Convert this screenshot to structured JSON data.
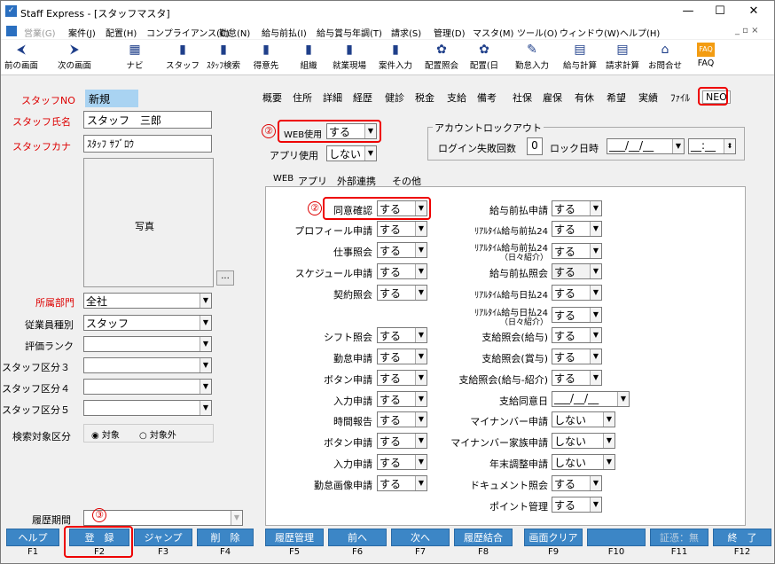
{
  "window": {
    "title": "Staff Express - [スタッフマスタ]",
    "min": "—",
    "max": "☐",
    "close": "✕"
  },
  "menu": [
    "営業(G)",
    "案件(J)",
    "配置(H)",
    "コンプライアンス(C)",
    "勤怠(N)",
    "給与前払(I)",
    "給与賞与年調(T)",
    "請求(S)",
    "管理(D)",
    "マスタ(M)",
    "ツール(O)",
    "ウィンドウ(W)",
    "ヘルプ(H)"
  ],
  "toolbar": [
    {
      "label": "前の画面",
      "icon": "arrow-left-icon",
      "glyph": "⮜"
    },
    {
      "label": "次の画面",
      "icon": "arrow-right-icon",
      "glyph": "⮞"
    },
    {
      "label": "ナビ",
      "icon": "navi-icon",
      "glyph": "▦"
    },
    {
      "label": "スタッフ",
      "icon": "staff-icon",
      "glyph": "▮"
    },
    {
      "label": "ｽﾀｯﾌ検索",
      "icon": "staff-search-icon",
      "glyph": "▮"
    },
    {
      "label": "得意先",
      "icon": "client-icon",
      "glyph": "▮"
    },
    {
      "label": "組織",
      "icon": "org-icon",
      "glyph": "▮"
    },
    {
      "label": "就業現場",
      "icon": "site-icon",
      "glyph": "▮"
    },
    {
      "label": "案件入力",
      "icon": "job-icon",
      "glyph": "▮"
    },
    {
      "label": "配置照会",
      "icon": "assign-icon",
      "glyph": "✿"
    },
    {
      "label": "配置(日",
      "icon": "assign-day-icon",
      "glyph": "✿"
    },
    {
      "label": "勤怠入力",
      "icon": "attendance-icon",
      "glyph": "✎"
    },
    {
      "label": "給与計算",
      "icon": "payroll-icon",
      "glyph": "▤"
    },
    {
      "label": "請求計算",
      "icon": "billing-icon",
      "glyph": "▤"
    },
    {
      "label": "お問合せ",
      "icon": "inquiry-icon",
      "glyph": "⌂"
    },
    {
      "label": "FAQ",
      "icon": "faq-icon",
      "glyph": "FAQ"
    }
  ],
  "left": {
    "staff_no_label": "スタッフNO",
    "staff_no_value": "新規",
    "name_label": "スタッフ氏名",
    "name_value": "スタッフ　三郎",
    "kana_label": "スタッフカナ",
    "kana_value": "ｽﾀｯﾌ ｻﾌﾞﾛｳ",
    "photo_label": "写真",
    "photo_btn": "...",
    "dept_label": "所属部門",
    "dept_value": "全社",
    "emp_type_label": "従業員種別",
    "emp_type_value": "スタッフ",
    "rank_label": "評価ランク",
    "cat3_label": "スタッフ区分３",
    "cat4_label": "スタッフ区分４",
    "cat5_label": "スタッフ区分５",
    "search_label": "検索対象区分",
    "radio_on": "対象",
    "radio_off": "対象外",
    "history_label": "履歴期間"
  },
  "tabs": [
    "概要",
    "住所",
    "詳細",
    "経歴",
    "健診",
    "税金",
    "支給",
    "備考",
    "社保",
    "雇保",
    "有休",
    "希望",
    "実績",
    "ﾌｧｲﾙ",
    "NEO"
  ],
  "neo": {
    "web_use_label": "WEB使用",
    "web_use_value": "する",
    "app_use_label": "アプリ使用",
    "app_use_value": "しない",
    "lock_group": "アカウントロックアウト",
    "login_fail_label": "ログイン失敗回数",
    "login_fail_value": "0",
    "lock_date_label": "ロック日時",
    "lock_date_value": "___/__/__",
    "lock_time_value": "__:__"
  },
  "subtabs": [
    "WEB",
    "アプリ",
    "外部連携",
    "その他"
  ],
  "web_left": [
    {
      "label": "同意確認",
      "value": "する"
    },
    {
      "label": "プロフィール申請",
      "value": "する"
    },
    {
      "label": "仕事照会",
      "value": "する"
    },
    {
      "label": "スケジュール申請",
      "value": "する"
    },
    {
      "label": "契約照会",
      "value": "する"
    },
    {
      "label": "シフト照会",
      "value": "する"
    },
    {
      "label": "勤怠申請",
      "value": "する"
    },
    {
      "label": "ボタン申請",
      "value": "する"
    },
    {
      "label": "入力申請",
      "value": "する"
    },
    {
      "label": "時間報告",
      "value": "する"
    },
    {
      "label": "ボタン申請",
      "value": "する"
    },
    {
      "label": "入力申請",
      "value": "する"
    },
    {
      "label": "勤怠画像申請",
      "value": "する"
    }
  ],
  "web_right": [
    {
      "label": "給与前払申請",
      "value": "する"
    },
    {
      "label": "ﾘｱﾙﾀｲﾑ給与前払24",
      "value": "する"
    },
    {
      "label": "ﾘｱﾙﾀｲﾑ給与前払24",
      "label2": "（日々紹介）",
      "value": "する"
    },
    {
      "label": "給与前払照会",
      "value": "する"
    },
    {
      "label": "ﾘｱﾙﾀｲﾑ給与日払24",
      "value": "する"
    },
    {
      "label": "ﾘｱﾙﾀｲﾑ給与日払24",
      "label2": "（日々紹介）",
      "value": "する"
    },
    {
      "label": "支給照会(給与)",
      "value": "する"
    },
    {
      "label": "支給照会(賞与)",
      "value": "する"
    },
    {
      "label": "支給照会(給与-紹介)",
      "value": "する"
    },
    {
      "label": "支給同意日",
      "value": "___/__/__"
    },
    {
      "label": "マイナンバー申請",
      "value": "しない"
    },
    {
      "label": "マイナンバー家族申請",
      "value": "しない"
    },
    {
      "label": "年末調整申請",
      "value": "しない"
    },
    {
      "label": "ドキュメント照会",
      "value": "する"
    },
    {
      "label": "ポイント管理",
      "value": "する"
    }
  ],
  "annotations": {
    "c2": "②",
    "c3": "③"
  },
  "fkeys": [
    {
      "label": "ヘルプ",
      "key": "F1"
    },
    {
      "label": "登　録",
      "key": "F2"
    },
    {
      "label": "ジャンプ",
      "key": "F3"
    },
    {
      "label": "削　除",
      "key": "F4"
    },
    {
      "label": "履歴管理",
      "key": "F5"
    },
    {
      "label": "前へ",
      "key": "F6"
    },
    {
      "label": "次へ",
      "key": "F7"
    },
    {
      "label": "履歴結合",
      "key": "F8"
    },
    {
      "label": "画面クリア",
      "key": "F9"
    },
    {
      "label": "",
      "key": "F10"
    },
    {
      "label": "証憑：無",
      "key": "F11"
    },
    {
      "label": "終　了",
      "key": "F12"
    }
  ]
}
